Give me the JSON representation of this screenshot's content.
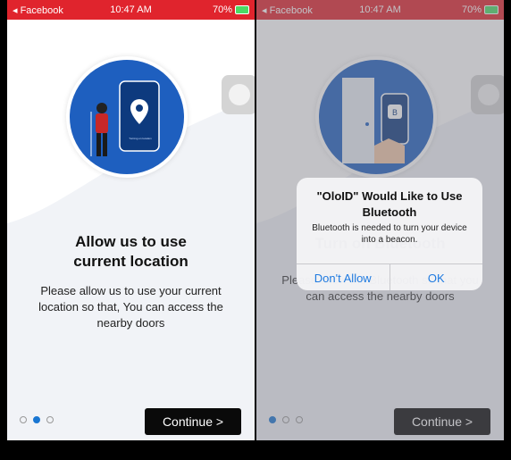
{
  "screen1": {
    "status": {
      "carrier": "◂ Facebook",
      "time": "10:47 AM",
      "battery": "70%"
    },
    "illustration_caption": "Turning on location",
    "title_line1": "Allow us to use",
    "title_line2": "current location",
    "description": "Please allow us to use your current location so that, You can access the nearby doors",
    "continue_label": "Continue >"
  },
  "screen2": {
    "status": {
      "carrier": "◂ Facebook",
      "time": "10:47 AM",
      "battery": "70%"
    },
    "background_title": "Turn on Bluetooth",
    "background_desc": "Please allow the Bluetooth so that you can access the nearby doors",
    "alert": {
      "title": "\"OloID\" Would Like to Use Bluetooth",
      "message": "Bluetooth is needed to turn your device into a beacon.",
      "dont_allow": "Don't Allow",
      "ok": "OK"
    },
    "continue_label": "Continue >"
  },
  "colors": {
    "accent": "#1976d2",
    "status_bar": "#e0242d",
    "hero": "#1e5fbf",
    "button": "#0a0a0a"
  },
  "icons": [
    "location-pin-icon",
    "bluetooth-icon",
    "wifi-icon",
    "battery-icon",
    "camera-button-icon"
  ]
}
